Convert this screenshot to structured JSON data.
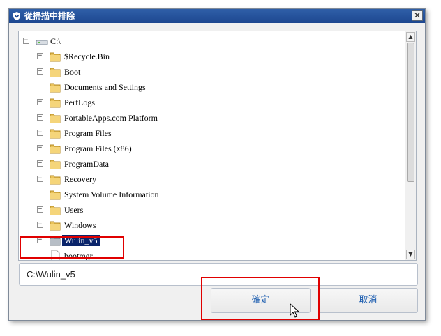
{
  "window": {
    "title": "從掃描中排除",
    "close_label": "✕"
  },
  "tree": {
    "root_label": "C:\\",
    "items": [
      {
        "label": "$Recycle.Bin",
        "expandable": true,
        "type": "folder"
      },
      {
        "label": "Boot",
        "expandable": true,
        "type": "folder"
      },
      {
        "label": "Documents and Settings",
        "expandable": false,
        "type": "folder"
      },
      {
        "label": "PerfLogs",
        "expandable": true,
        "type": "folder"
      },
      {
        "label": "PortableApps.com Platform",
        "expandable": true,
        "type": "folder"
      },
      {
        "label": "Program Files",
        "expandable": true,
        "type": "folder"
      },
      {
        "label": "Program Files (x86)",
        "expandable": true,
        "type": "folder"
      },
      {
        "label": "ProgramData",
        "expandable": true,
        "type": "folder"
      },
      {
        "label": "Recovery",
        "expandable": true,
        "type": "folder"
      },
      {
        "label": "System Volume Information",
        "expandable": false,
        "type": "folder"
      },
      {
        "label": "Users",
        "expandable": true,
        "type": "folder"
      },
      {
        "label": "Windows",
        "expandable": true,
        "type": "folder"
      },
      {
        "label": "Wulin_v5",
        "expandable": true,
        "type": "folder",
        "selected": true
      },
      {
        "label": "bootmgr",
        "expandable": false,
        "type": "file"
      }
    ]
  },
  "path_field": {
    "value": "C:\\Wulin_v5"
  },
  "buttons": {
    "ok": "確定",
    "cancel": "取消"
  },
  "colors": {
    "selection": "#0a246a",
    "highlight": "#e00000",
    "titlebar": "#1d4790",
    "button_text": "#1f5fb0"
  }
}
